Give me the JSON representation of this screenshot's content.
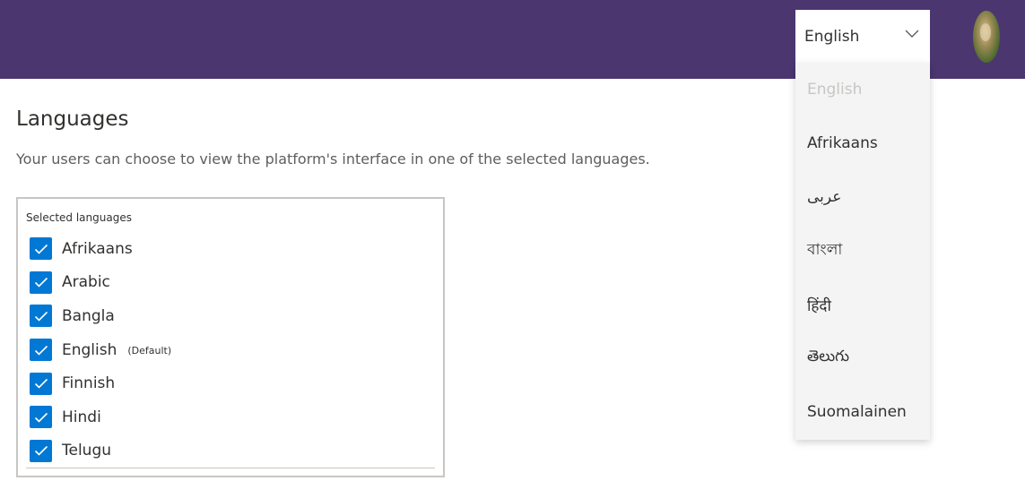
{
  "header": {
    "language_select": {
      "value": "English",
      "options": [
        "English",
        "Afrikaans",
        "عربى",
        "বাংলা",
        "हिंदी",
        "తెలుగు",
        "Suomalainen"
      ]
    },
    "avatar_icon": "user-avatar"
  },
  "main": {
    "title": "Languages",
    "description": "Your users can choose to view the platform's interface in one of the selected languages.",
    "box_label": "Selected languages",
    "languages": [
      {
        "name": "Afrikaans",
        "checked": true,
        "tag": ""
      },
      {
        "name": "Arabic",
        "checked": true,
        "tag": ""
      },
      {
        "name": "Bangla",
        "checked": true,
        "tag": ""
      },
      {
        "name": "English",
        "checked": true,
        "tag": "(Default)"
      },
      {
        "name": "Finnish",
        "checked": true,
        "tag": ""
      },
      {
        "name": "Hindi",
        "checked": true,
        "tag": ""
      },
      {
        "name": "Telugu",
        "checked": true,
        "tag": ""
      }
    ]
  },
  "colors": {
    "topbar": "#4b3670",
    "checkbox": "#0078d4"
  }
}
